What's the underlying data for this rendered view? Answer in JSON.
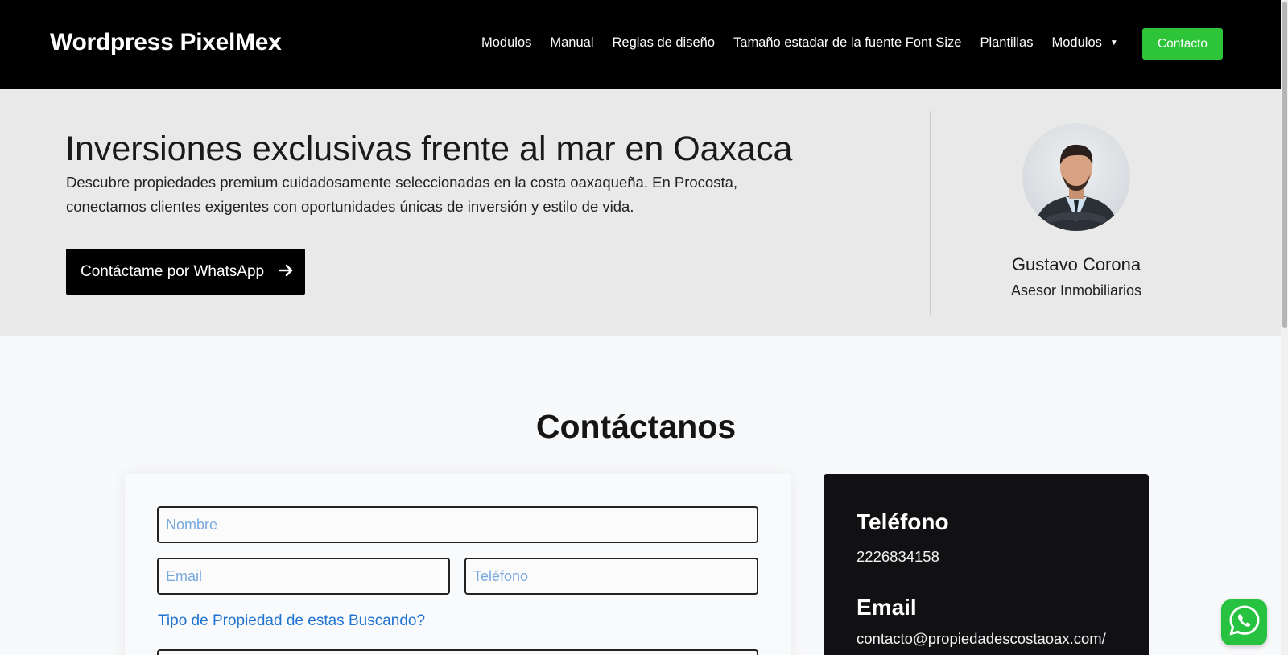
{
  "header": {
    "brand": "Wordpress PixelMex",
    "nav": [
      {
        "label": "Modulos"
      },
      {
        "label": "Manual"
      },
      {
        "label": "Reglas de diseño"
      },
      {
        "label": "Tamaño estadar de la fuente Font Size"
      },
      {
        "label": "Plantillas"
      },
      {
        "label": "Modulos"
      }
    ],
    "cta": "Contacto"
  },
  "hero": {
    "title": "Inversiones exclusivas frente al mar en Oaxaca",
    "description": "Descubre propiedades premium cuidadosamente seleccionadas en la costa oaxaqueña. En Procosta, conectamos clientes exigentes con oportunidades únicas de inversión y estilo de vida.",
    "whatsapp_button": "Contáctame por WhatsApp",
    "agent": {
      "name": "Gustavo Corona",
      "role": "Asesor Inmobiliarios"
    }
  },
  "contact": {
    "title": "Contáctanos",
    "form": {
      "nombre_placeholder": "Nombre",
      "email_placeholder": "Email",
      "telefono_placeholder": "Teléfono",
      "property_type_label": "Tipo de Propiedad de estas Buscando?"
    },
    "info": {
      "phone_heading": "Teléfono",
      "phone_value": "2226834158",
      "email_heading": "Email",
      "email_value": "contacto@propiedadescostaoax.com/"
    }
  },
  "colors": {
    "accent_green": "#2dc43a",
    "whatsapp_green": "#27c23f",
    "link_blue": "#1f73d3",
    "hero_bg": "#e9e9e9"
  }
}
